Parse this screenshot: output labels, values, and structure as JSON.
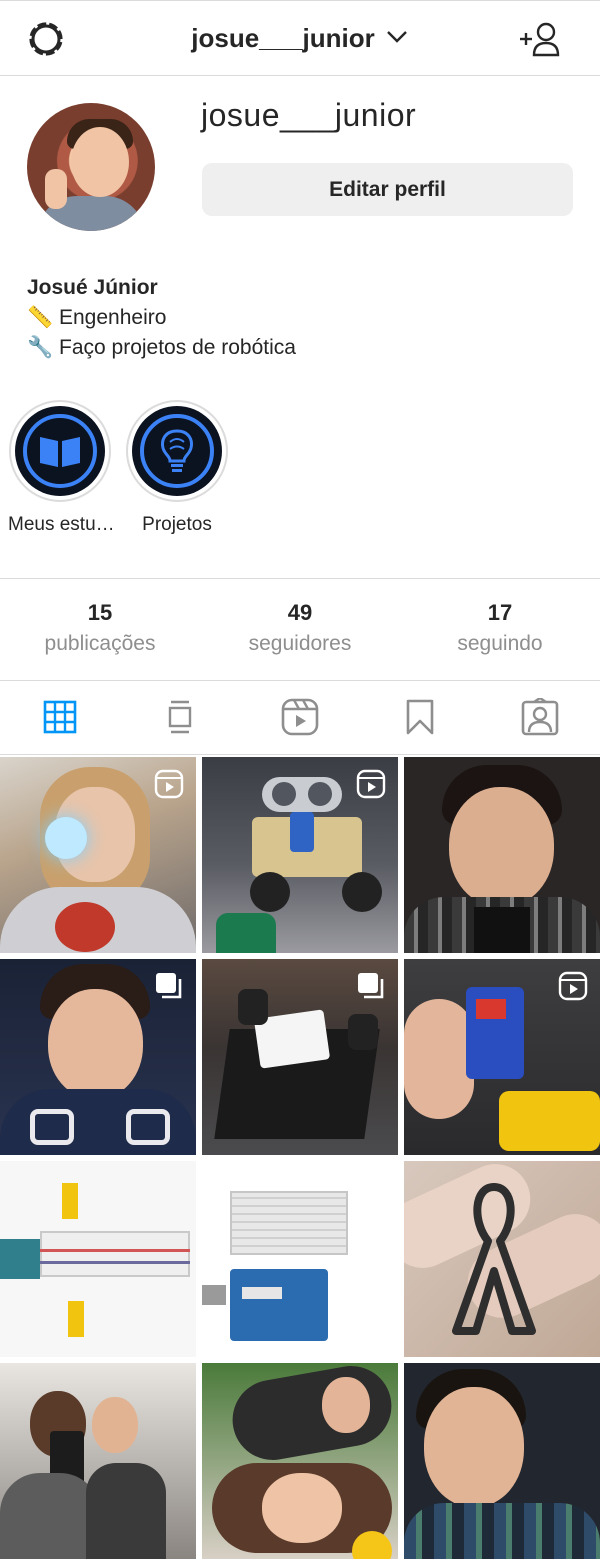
{
  "topbar": {
    "username": "josue___junior",
    "settings_icon": "gear-icon",
    "dropdown_icon": "chevron-down-icon",
    "add_user_icon": "add-user-icon"
  },
  "profile": {
    "username": "josue___junior",
    "edit_button": "Editar perfil",
    "display_name": "Josué Júnior",
    "bio_lines": [
      {
        "emoji": "📏",
        "text": "Engenheiro"
      },
      {
        "emoji": "🔧",
        "text": "Faço projetos de robótica"
      }
    ]
  },
  "highlights": [
    {
      "label": "Meus estu…",
      "icon": "book-icon"
    },
    {
      "label": "Projetos",
      "icon": "lightbulb-brain-icon"
    }
  ],
  "stats": [
    {
      "value": "15",
      "label": "publicações"
    },
    {
      "value": "49",
      "label": "seguidores"
    },
    {
      "value": "17",
      "label": "seguindo"
    }
  ],
  "tabs": [
    {
      "name": "grid",
      "icon": "grid-icon",
      "active": true
    },
    {
      "name": "feed",
      "icon": "feed-icon",
      "active": false
    },
    {
      "name": "reels",
      "icon": "reels-icon",
      "active": false
    },
    {
      "name": "saved",
      "icon": "bookmark-icon",
      "active": false
    },
    {
      "name": "tagged",
      "icon": "tagged-icon",
      "active": false
    }
  ],
  "colors": {
    "accent": "#0095f6",
    "muted": "#8e8e8e",
    "divider": "#dbdbdb",
    "button_bg": "#efefef"
  }
}
